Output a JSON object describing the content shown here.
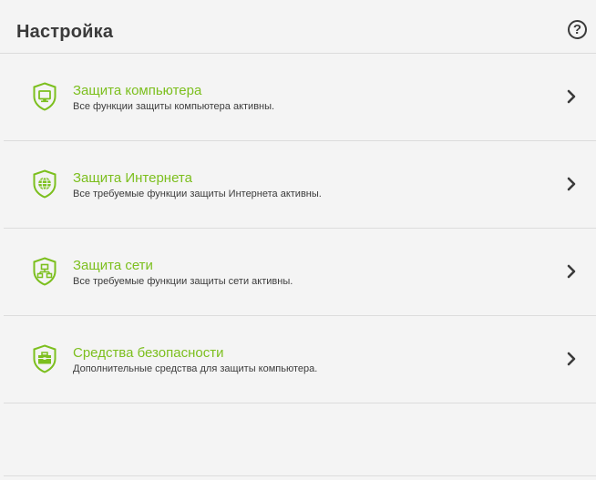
{
  "header": {
    "title": "Настройка",
    "help_label": "?"
  },
  "colors": {
    "accent": "#7cbf1e",
    "text": "#3a3a3a",
    "divider": "#dcdcdc",
    "background": "#f4f4f4"
  },
  "items": [
    {
      "icon": "shield-monitor-icon",
      "title": "Защита компьютера",
      "description": "Все функции защиты компьютера активны."
    },
    {
      "icon": "shield-globe-icon",
      "title": "Защита Интернета",
      "description": "Все требуемые функции защиты Интернета активны."
    },
    {
      "icon": "shield-network-icon",
      "title": "Защита сети",
      "description": "Все требуемые функции защиты сети активны."
    },
    {
      "icon": "shield-toolbox-icon",
      "title": "Средства безопасности",
      "description": "Дополнительные средства для защиты компьютера."
    }
  ]
}
